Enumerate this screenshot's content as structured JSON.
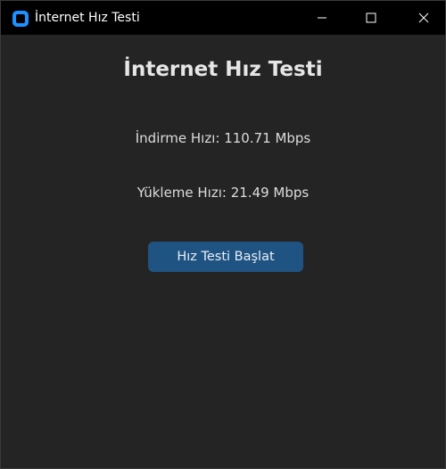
{
  "window": {
    "title": "İnternet Hız Testi",
    "controls": {
      "minimize": "minimize-icon",
      "maximize": "maximize-icon",
      "close": "close-icon"
    }
  },
  "main": {
    "heading": "İnternet Hız Testi",
    "download_text": "İndirme Hızı: 110.71 Mbps",
    "upload_text": "Yükleme Hızı: 21.49 Mbps",
    "start_button_label": "Hız Testi Başlat"
  },
  "colors": {
    "background": "#242424",
    "titlebar": "#000000",
    "button": "#1f5382",
    "app_icon": "#1e90ff"
  }
}
